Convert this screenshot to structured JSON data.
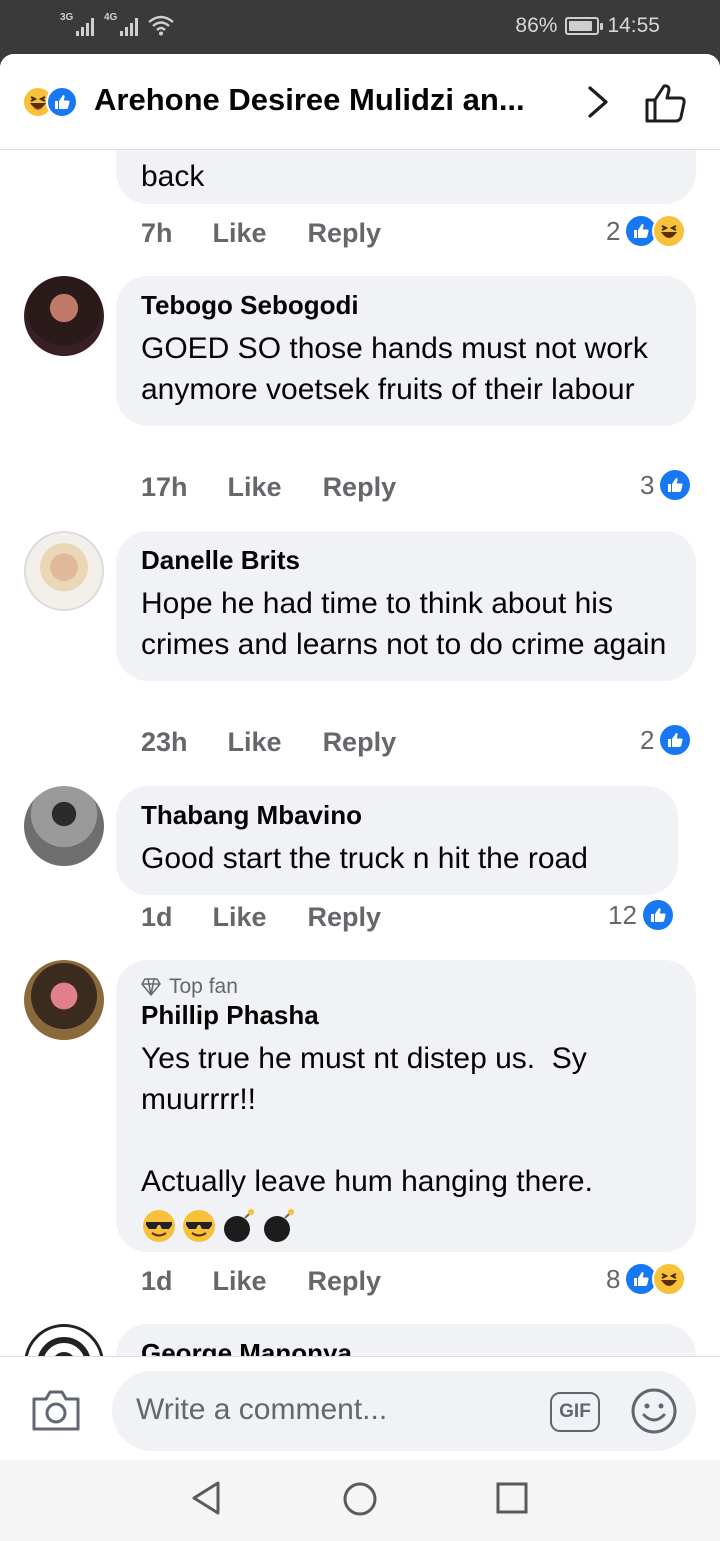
{
  "status": {
    "net1": "3G",
    "net2": "4G",
    "battery": "86%",
    "battery_level": 0.86,
    "time": "14:55"
  },
  "header": {
    "title": "Arehone Desiree Mulidzi an..."
  },
  "actions": {
    "like": "Like",
    "reply": "Reply"
  },
  "partial_top": {
    "text": "back",
    "time": "7h",
    "reactions": "2"
  },
  "comments": [
    {
      "name": "Tebogo Sebogodi",
      "text": "GOED SO those hands must not work anymore voetsek fruits of their labour",
      "time": "17h",
      "reactions": "3"
    },
    {
      "name": "Danelle Brits",
      "text": "Hope he had time to think about his crimes and learns not to do crime again",
      "time": "23h",
      "reactions": "2"
    },
    {
      "name": "Thabang Mbavino",
      "text": "Good start the truck n hit the road",
      "time": "1d",
      "reactions": "12"
    },
    {
      "badge": "Top fan",
      "name": "Phillip Phasha",
      "text": "Yes true he must nt distep us.  Sy muurrrr!!",
      "text2": "Actually leave hum hanging there.",
      "time": "1d",
      "reactions": "8"
    },
    {
      "name": "George Manonya"
    }
  ],
  "composer": {
    "placeholder": "Write a comment...",
    "gif": "GIF"
  },
  "icons": [
    "camera-icon",
    "gif-icon",
    "emoji-icon",
    "chevron-right-icon",
    "thumbs-up-icon",
    "back-nav-icon",
    "home-nav-icon",
    "recents-nav-icon"
  ]
}
